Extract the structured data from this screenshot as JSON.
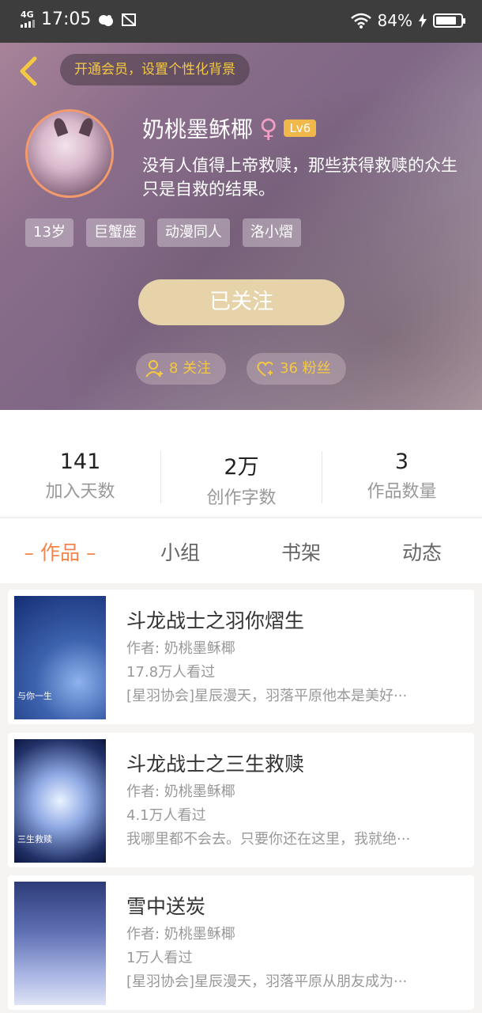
{
  "status_bar": {
    "network": "4G",
    "time": "17:05",
    "battery": "84%",
    "battery_level": 0.84
  },
  "header": {
    "vip_banner": "开通会员，设置个性化背景",
    "name": "奶桃墨稣椰",
    "gender_symbol": "♀",
    "level": "Lv6",
    "bio": "没有人值得上帝救赎，那些获得救赎的众生只是自救的结果。",
    "tags": [
      "13岁",
      "巨蟹座",
      "动漫同人",
      "洛小熠"
    ],
    "follow_button": "已关注",
    "following": "8 关注",
    "fans": "36 粉丝"
  },
  "stats": [
    {
      "value": "141",
      "label": "加入天数"
    },
    {
      "value": "2万",
      "label": "创作字数"
    },
    {
      "value": "3",
      "label": "作品数量"
    }
  ],
  "tabs": [
    "– 作品 –",
    "小组",
    "书架",
    "动态"
  ],
  "works": [
    {
      "title": "斗龙战士之羽你熠生",
      "author": "作者: 奶桃墨稣椰",
      "views": "17.8万人看过",
      "desc": "[星羽协会]星辰漫天，羽落平原他本是美好···",
      "cover_text": "与你一生"
    },
    {
      "title": "斗龙战士之三生救赎",
      "author": "作者: 奶桃墨稣椰",
      "views": "4.1万人看过",
      "desc": "我哪里都不会去。只要你还在这里，我就绝···",
      "cover_text": "三生救赎"
    },
    {
      "title": "雪中送炭",
      "author": "作者: 奶桃墨稣椰",
      "views": "1万人看过",
      "desc": "[星羽协会]星辰漫天，羽落平原从朋友成为···",
      "cover_text": ""
    }
  ],
  "colors": {
    "accent": "#f3844d",
    "vip": "#f5c842",
    "follow_btn": "#e6d3aa"
  }
}
